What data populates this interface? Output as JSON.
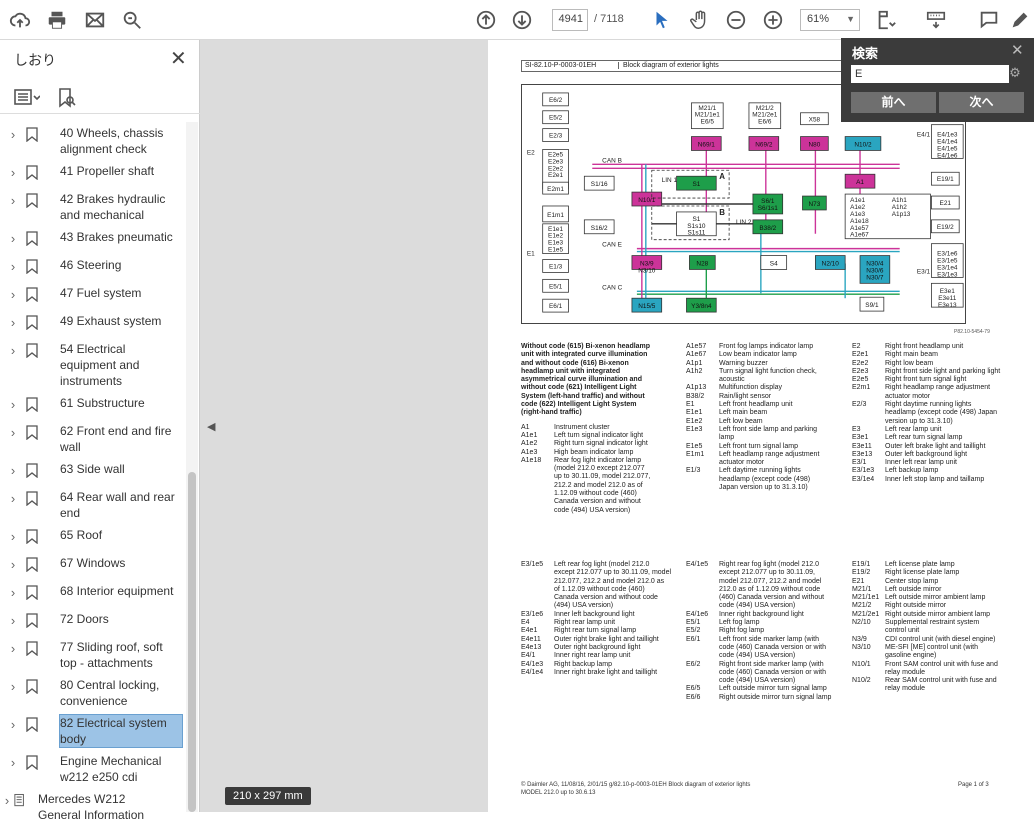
{
  "toolbar": {
    "page_current": "4941",
    "page_total": "/ 7118",
    "zoom": "61%",
    "icons": [
      "cloud-upload-icon",
      "print-icon",
      "mail-icon",
      "zoom-search-icon",
      "page-up-icon",
      "page-down-icon",
      "select-cursor-icon",
      "hand-icon",
      "zoom-out-icon",
      "zoom-in-icon",
      "fit-page-icon",
      "keyboard-icon",
      "comment-icon",
      "pen-icon"
    ]
  },
  "sidebar": {
    "title": "しおり",
    "items": [
      {
        "label": "40 Wheels, chassis alignment check",
        "active": false
      },
      {
        "label": "41 Propeller shaft",
        "active": false
      },
      {
        "label": "42 Brakes hydraulic and mechanical",
        "active": false
      },
      {
        "label": "43 Brakes pneumatic",
        "active": false
      },
      {
        "label": "46 Steering",
        "active": false
      },
      {
        "label": "47 Fuel system",
        "active": false
      },
      {
        "label": "49 Exhaust system",
        "active": false
      },
      {
        "label": "54 Electrical equipment and instruments",
        "active": false
      },
      {
        "label": "61 Substructure",
        "active": false
      },
      {
        "label": "62 Front end and fire wall",
        "active": false
      },
      {
        "label": "63 Side wall",
        "active": false
      },
      {
        "label": "64 Rear wall and rear end",
        "active": false
      },
      {
        "label": "65 Roof",
        "active": false
      },
      {
        "label": "67 Windows",
        "active": false
      },
      {
        "label": "68 Interior equipment",
        "active": false
      },
      {
        "label": "72 Doors",
        "active": false
      },
      {
        "label": "77 Sliding roof, soft top - attachments",
        "active": false
      },
      {
        "label": "80 Central locking, convenience",
        "active": false
      },
      {
        "label": "82 Electrical system body",
        "active": true
      },
      {
        "label": "Engine Mechanical w212 e250 cdi",
        "active": false
      },
      {
        "label": "Mercedes W212 General Information",
        "active": false
      }
    ]
  },
  "page_size_label": "210 x 297 mm",
  "document": {
    "header_left": "SI-82.10-P-0003-01EH",
    "header_title": "Block diagram of exterior lights",
    "diagram_id": "P82.10-5454-79",
    "intro": "Without code (615) Bi-xenon headlamp unit with integrated curve illumination and without code (616) Bi-xenon headlamp unit with integrated asymmetrical curve illumination and without code (621) Intelligent Light System (left-hand traffic) and without code (622) Intelligent Light System (right-hand traffic)",
    "col1_entries": [
      {
        "k": "A1",
        "v": "Instrument cluster"
      },
      {
        "k": "A1e1",
        "v": "Left turn signal indicator light"
      },
      {
        "k": "A1e2",
        "v": "Right turn signal indicator light"
      },
      {
        "k": "A1e3",
        "v": "High beam indicator lamp"
      },
      {
        "k": "A1e18",
        "v": "Rear fog light indicator lamp (model 212.0 except 212.077 up to 30.11.09, model 212.077, 212.2 and model 212.0 as of 1.12.09 without code (460) Canada version and without code (494) USA version)"
      }
    ],
    "col2_entries": [
      {
        "k": "A1e57",
        "v": "Front fog lamps indicator lamp"
      },
      {
        "k": "A1e67",
        "v": "Low beam indicator lamp"
      },
      {
        "k": "A1p1",
        "v": "Warning buzzer"
      },
      {
        "k": "A1h2",
        "v": "Turn signal light function check, acoustic"
      },
      {
        "k": "A1p13",
        "v": "Multifunction display"
      },
      {
        "k": "B38/2",
        "v": "Rain/light sensor"
      },
      {
        "k": "E1",
        "v": "Left front headlamp unit"
      },
      {
        "k": "E1e1",
        "v": "Left main beam"
      },
      {
        "k": "E1e2",
        "v": "Left low beam"
      },
      {
        "k": "E1e3",
        "v": "Left front side lamp and parking lamp"
      },
      {
        "k": "E1e5",
        "v": "Left front turn signal lamp"
      },
      {
        "k": "E1m1",
        "v": "Left headlamp range adjustment actuator motor"
      },
      {
        "k": "E1/3",
        "v": "Left daytime running lights headlamp (except code (498) Japan version up to 31.3.10)"
      }
    ],
    "col3_entries": [
      {
        "k": "E2",
        "v": "Right front headlamp unit"
      },
      {
        "k": "E2e1",
        "v": "Right main beam"
      },
      {
        "k": "E2e2",
        "v": "Right low beam"
      },
      {
        "k": "E2e3",
        "v": "Right front side light and parking light"
      },
      {
        "k": "E2e5",
        "v": "Right front turn signal light"
      },
      {
        "k": "E2m1",
        "v": "Right headlamp range adjustment actuator motor"
      },
      {
        "k": "E2/3",
        "v": "Right daytime running lights headlamp (except code (498) Japan version up to 31.3.10)"
      },
      {
        "k": "E3",
        "v": "Left rear lamp unit"
      },
      {
        "k": "E3e1",
        "v": "Left rear turn signal lamp"
      },
      {
        "k": "E3e11",
        "v": "Outer left brake light and taillight"
      },
      {
        "k": "E3e13",
        "v": "Outer left background light"
      },
      {
        "k": "E3/1",
        "v": "Inner left rear lamp unit"
      },
      {
        "k": "E3/1e3",
        "v": "Left backup lamp"
      },
      {
        "k": "E3/1e4",
        "v": "Inner left stop lamp and taillamp"
      }
    ],
    "col4_entries": [
      {
        "k": "E3/1e5",
        "v": "Left rear fog light (model 212.0 except 212.077 up to 30.11.09, model 212.077, 212.2 and model 212.0 as of 1.12.09 without code (460) Canada version and without code (494) USA version)"
      },
      {
        "k": "E3/1e6",
        "v": "Inner left background light"
      },
      {
        "k": "E4",
        "v": "Right rear lamp unit"
      },
      {
        "k": "E4e1",
        "v": "Right rear turn signal lamp"
      },
      {
        "k": "E4e11",
        "v": "Outer right brake light and taillight"
      },
      {
        "k": "E4e13",
        "v": "Outer right background light"
      },
      {
        "k": "E4/1",
        "v": "Inner right rear lamp unit"
      },
      {
        "k": "E4/1e3",
        "v": "Right backup lamp"
      },
      {
        "k": "E4/1e4",
        "v": "Inner right brake light and taillight"
      }
    ],
    "col5_entries": [
      {
        "k": "E4/1e5",
        "v": "Right rear fog light (model 212.0 except 212.077 up to 30.11.09, model 212.077, 212.2 and model 212.0 as of 1.12.09 without code (460) Canada version and without code (494) USA version)"
      },
      {
        "k": "E4/1e6",
        "v": "Inner right background light"
      },
      {
        "k": "E5/1",
        "v": "Left fog lamp"
      },
      {
        "k": "E5/2",
        "v": "Right fog lamp"
      },
      {
        "k": "E6/1",
        "v": "Left front side marker lamp (with code (460) Canada version or with code (494) USA version)"
      },
      {
        "k": "E6/2",
        "v": "Right front side marker lamp (with code (460) Canada version or with code (494) USA version)"
      },
      {
        "k": "E6/5",
        "v": "Left outside mirror turn signal lamp"
      },
      {
        "k": "E6/6",
        "v": "Right outside mirror turn signal lamp"
      }
    ],
    "col6_entries": [
      {
        "k": "E19/1",
        "v": "Left license plate lamp"
      },
      {
        "k": "E19/2",
        "v": "Right license plate lamp"
      },
      {
        "k": "E21",
        "v": "Center stop lamp"
      },
      {
        "k": "M21/1",
        "v": "Left outside mirror"
      },
      {
        "k": "M21/1e1",
        "v": "Left outside mirror ambient lamp"
      },
      {
        "k": "M21/2",
        "v": "Right outside mirror"
      },
      {
        "k": "M21/2e1",
        "v": "Right outside mirror ambient lamp"
      },
      {
        "k": "N2/10",
        "v": "Supplemental restraint system control unit"
      },
      {
        "k": "N3/9",
        "v": "CDI control unit (with diesel engine)"
      },
      {
        "k": "N3/10",
        "v": "ME-SFI [ME] control unit (with gasoline engine)"
      },
      {
        "k": "N10/1",
        "v": "Front SAM control unit with fuse and relay module"
      },
      {
        "k": "N10/2",
        "v": "Rear SAM control unit with fuse and relay module"
      }
    ],
    "footer1": "© Daimler AG, 11/08/16, 2/01/15 g/82.10-p-0003-01EH Block diagram of exterior lights",
    "footer2": "MODEL 212.0 up to 30.6.13",
    "page_label": "Page 1 of 3"
  },
  "diagram": {
    "left_boxes": [
      "E6/2",
      "E5/2",
      "E2/3",
      "E2m1",
      "E1m1",
      "E5/1",
      "E6/1",
      "E1/3"
    ],
    "e2_group": [
      "E2e5",
      "E2e3",
      "E2e2",
      "E2e1"
    ],
    "e1_group": [
      "E1e1",
      "E1e2",
      "E1e3",
      "E1e5"
    ],
    "e2_label": "E2",
    "e1_label": "E1",
    "top_boxes": [
      {
        "id": "m21-1",
        "label": "M21/1\nM21/1e1\nE6/5"
      },
      {
        "id": "m21-2",
        "label": "M21/2\nM21/2e1\nE6/6"
      },
      {
        "id": "x58",
        "label": "X58"
      }
    ],
    "modules": [
      "N69/1",
      "N69/2",
      "N80",
      "N10/2",
      "N10/1",
      "N73",
      "A1",
      "N2/10",
      "N3/9\nN3/10",
      "N28",
      "S4",
      "N30/4\nN30/6\nN30/7",
      "N15/5",
      "Y3/8n4",
      "S1/16",
      "S16/2",
      "S6/1\nS6/1s1",
      "B38/2",
      "S1",
      "S1\nS1s10\nS1s11",
      "S9/1"
    ],
    "can_labels": [
      "CAN B",
      "LIN 1",
      "LIN 2",
      "CAN E",
      "CAN C",
      "A",
      "B"
    ],
    "a1_sub": [
      "A1e1\nA1e2\nA1e3\nA1e18\nA1e57\nA1e67",
      "A1h1\nA1h2\nA1p13"
    ],
    "right_boxes": [
      "E19/1",
      "E21",
      "E19/2",
      "E3e1\nE3e11\nE3e13",
      "E4/1",
      "E4/1e3\nE4/1e4\nE4/1e5\nE4/1e6",
      "E3/1e6\nE3/1e5\nE3/1e4\nE3/1e3",
      "E3/1",
      "E4",
      "E4e1\nE4e11\nE4e13"
    ]
  },
  "search": {
    "title": "検索",
    "input_value": "E",
    "prev_label": "前へ",
    "next_label": "次へ"
  },
  "colors": {
    "magenta": "#cc3399",
    "green": "#1e9e4a",
    "cyan": "#2aa5c0",
    "highlight": "#9cc3e6",
    "search_bg": "#3b3b3b"
  }
}
